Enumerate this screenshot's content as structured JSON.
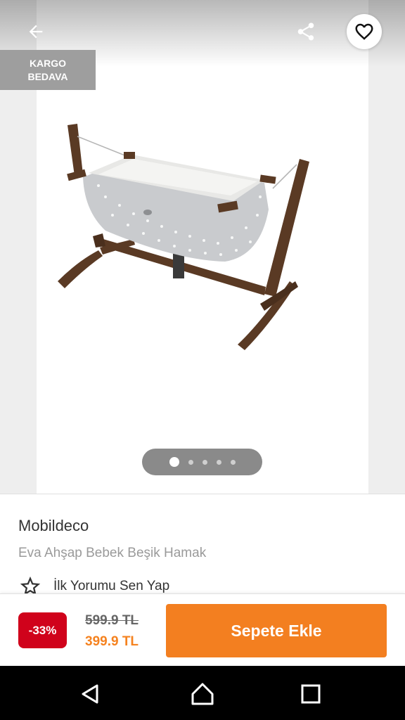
{
  "gallery": {
    "cargo_badge_line1": "KARGO",
    "cargo_badge_line2": "BEDAVA",
    "image_count": 5,
    "active_index": 0,
    "icons": {
      "back": "arrow-left-icon",
      "share": "share-icon",
      "favorite": "heart-outline-icon"
    }
  },
  "product": {
    "brand": "Mobildeco",
    "name": "Eva Ahşap Bebek Beşik Hamak",
    "review_cta": "İlk Yorumu Sen Yap",
    "review_icon": "star-outline-icon"
  },
  "purchase": {
    "discount": "-33%",
    "old_price": "599.9 TL",
    "new_price": "399.9 TL",
    "add_to_cart_label": "Sepete Ekle"
  },
  "colors": {
    "accent_orange": "#f37f20",
    "price_orange": "#f5821f",
    "discount_red": "#d0021b",
    "badge_gray": "#9e9e9e"
  },
  "system_nav": {
    "back": "nav-back-icon",
    "home": "nav-home-icon",
    "recents": "nav-recents-icon"
  }
}
